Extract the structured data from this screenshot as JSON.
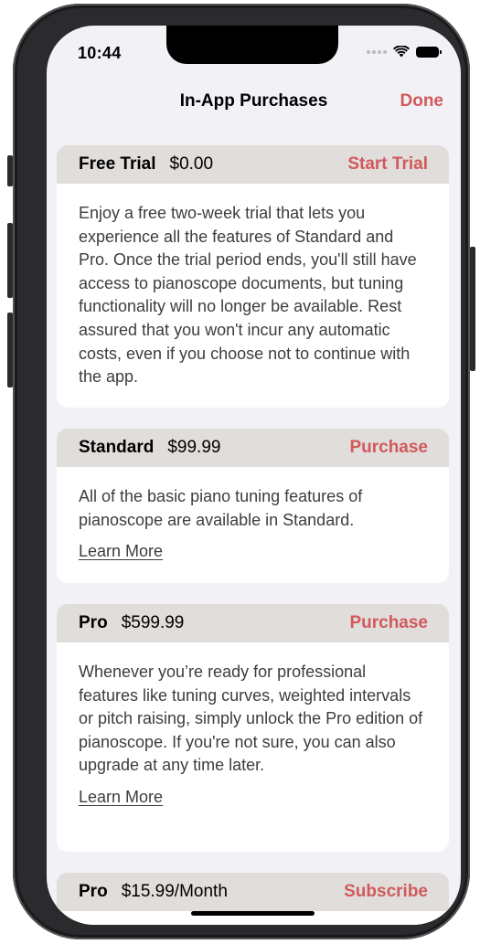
{
  "status_bar": {
    "time": "10:44",
    "icons": [
      "signal-dots-icon",
      "wifi-icon",
      "battery-icon"
    ]
  },
  "navbar": {
    "title": "In-App Purchases",
    "done_label": "Done"
  },
  "colors": {
    "accent": "#d05a5c",
    "card_header_bg": "#e1dddb",
    "screen_bg": "#f2f1f6",
    "body_text": "#3d3d3f"
  },
  "products": [
    {
      "name": "Free Trial",
      "price": "$0.00",
      "action": "Start Trial",
      "description": "Enjoy a free two-week trial that lets you experience all the features of Standard and Pro. Once the trial period ends, you'll still have access to pianoscope documents, but tuning functionality will no longer be available. Rest assured that you won't incur any automatic costs, even if you choose not to continue with the app."
    },
    {
      "name": "Standard",
      "price": "$99.99",
      "action": "Purchase",
      "description": "All of the basic piano tuning features of pianoscope are available in Standard.",
      "learn_more": "Learn More"
    },
    {
      "name": "Pro",
      "price": "$599.99",
      "action": "Purchase",
      "description": "Whenever you’re ready for professional features like tuning curves, weighted intervals or pitch raising, simply unlock the Pro edition of pianoscope. If you're not sure, you can also upgrade at any time later.",
      "learn_more": "Learn More"
    },
    {
      "name": "Pro",
      "price": "$15.99/Month",
      "action": "Subscribe"
    }
  ]
}
